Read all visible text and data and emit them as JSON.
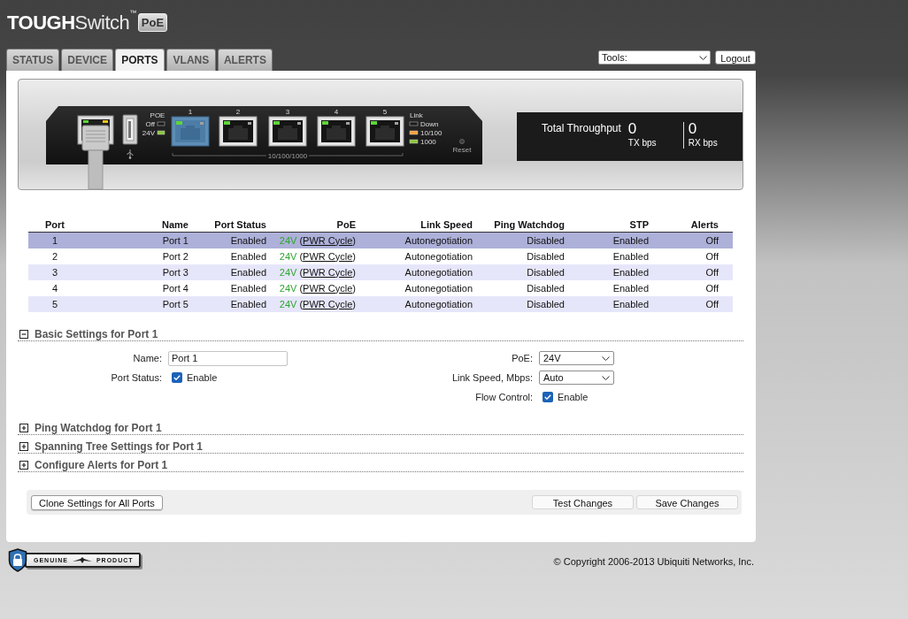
{
  "header": {
    "logo": {
      "text": "**TOUGH**Switch$^{™}$",
      "badge": "PoE"
    },
    "tabs": [
      {
        "label": "STATUS",
        "selected": false
      },
      {
        "label": "DEVICE",
        "selected": false
      },
      {
        "label": "PORTS",
        "selected": true
      },
      {
        "label": "VLANS",
        "selected": false
      },
      {
        "label": "ALERTS",
        "selected": false
      }
    ],
    "tools": {
      "value": "Tools:"
    },
    "logout": "Logout"
  },
  "device": {
    "poe_title": "POE",
    "poe_states": [
      {
        "label": "Off",
        "color": "#1a1a1a"
      },
      {
        "label": "24V",
        "color": "#8cc63f"
      }
    ],
    "ports": [
      {
        "label": "1",
        "selected": true,
        "link": true
      },
      {
        "label": "2",
        "selected": false,
        "link": true
      },
      {
        "label": "3",
        "selected": false,
        "link": true
      },
      {
        "label": "4",
        "selected": false,
        "link": true
      },
      {
        "label": "5",
        "selected": false,
        "link": true
      }
    ],
    "ports_speed": "10/100/1000",
    "legend_title": "Link",
    "legend": [
      {
        "label": "Down",
        "color": "#1a1a1a"
      },
      {
        "label": "10/100",
        "color": "#f7a33b"
      },
      {
        "label": "1000",
        "color": "#8cc63f"
      }
    ],
    "reset": "Reset"
  },
  "throughput": {
    "title": "Total Throughput",
    "tx": {
      "value": "0",
      "unit": "TX bps"
    },
    "rx": {
      "value": "0",
      "unit": "RX bps"
    }
  },
  "table": {
    "columns": [
      "Port",
      "Name",
      "Port Status",
      "PoE",
      "Link Speed",
      "Ping Watchdog",
      "STP",
      "Alerts"
    ],
    "rows": [
      {
        "selected": true,
        "port": "1",
        "name": "Port 1",
        "status": "Enabled",
        "poe": {
          "voltage": "24V",
          "open": "(",
          "link": "PWR Cycle",
          "close": ")"
        },
        "link_speed": "Autonegotiation",
        "ping_watchdog": "Disabled",
        "stp": "Enabled",
        "alerts": "Off"
      },
      {
        "selected": false,
        "port": "2",
        "name": "Port 2",
        "status": "Enabled",
        "poe": {
          "voltage": "24V",
          "open": "(",
          "link": "PWR Cycle",
          "close": ")"
        },
        "link_speed": "Autonegotiation",
        "ping_watchdog": "Disabled",
        "stp": "Enabled",
        "alerts": "Off"
      },
      {
        "selected": false,
        "port": "3",
        "name": "Port 3",
        "status": "Enabled",
        "poe": {
          "voltage": "24V",
          "open": "(",
          "link": "PWR Cycle",
          "close": ")"
        },
        "link_speed": "Autonegotiation",
        "ping_watchdog": "Disabled",
        "stp": "Enabled",
        "alerts": "Off"
      },
      {
        "selected": false,
        "port": "4",
        "name": "Port 4",
        "status": "Enabled",
        "poe": {
          "voltage": "24V",
          "open": "(",
          "link": "PWR Cycle",
          "close": ")"
        },
        "link_speed": "Autonegotiation",
        "ping_watchdog": "Disabled",
        "stp": "Enabled",
        "alerts": "Off"
      },
      {
        "selected": false,
        "port": "5",
        "name": "Port 5",
        "status": "Enabled",
        "poe": {
          "voltage": "24V",
          "open": "(",
          "link": "PWR Cycle",
          "close": ")"
        },
        "link_speed": "Autonegotiation",
        "ping_watchdog": "Disabled",
        "stp": "Enabled",
        "alerts": "Off"
      }
    ]
  },
  "sections": [
    {
      "title": "Basic Settings for Port 1",
      "expanded": true,
      "fields": {
        "left": [
          {
            "kind": "text",
            "label": "Name:",
            "value": "Port 1"
          },
          {
            "kind": "checkbox",
            "label": "Port Status:",
            "checked": true,
            "text": "Enable"
          }
        ],
        "right": [
          {
            "kind": "select",
            "label": "PoE:",
            "value": "24V"
          },
          {
            "kind": "select",
            "label": "Link Speed, Mbps:",
            "value": "Auto"
          },
          {
            "kind": "checkbox",
            "label": "Flow Control:",
            "checked": true,
            "text": "Enable"
          }
        ]
      }
    },
    {
      "title": "Ping Watchdog for Port 1",
      "expanded": false
    },
    {
      "title": "Spanning Tree Settings for Port 1",
      "expanded": false
    },
    {
      "title": "Configure Alerts for Port 1",
      "expanded": false
    }
  ],
  "actions": {
    "left": [
      "Clone Settings for All Ports"
    ],
    "right": [
      "Test Changes",
      "Save Changes"
    ]
  },
  "footer": {
    "badge": {
      "left": "GENUINE",
      "right": "PRODUCT"
    },
    "copyright": "© Copyright 2006-2013 Ubiquiti Networks, Inc."
  }
}
